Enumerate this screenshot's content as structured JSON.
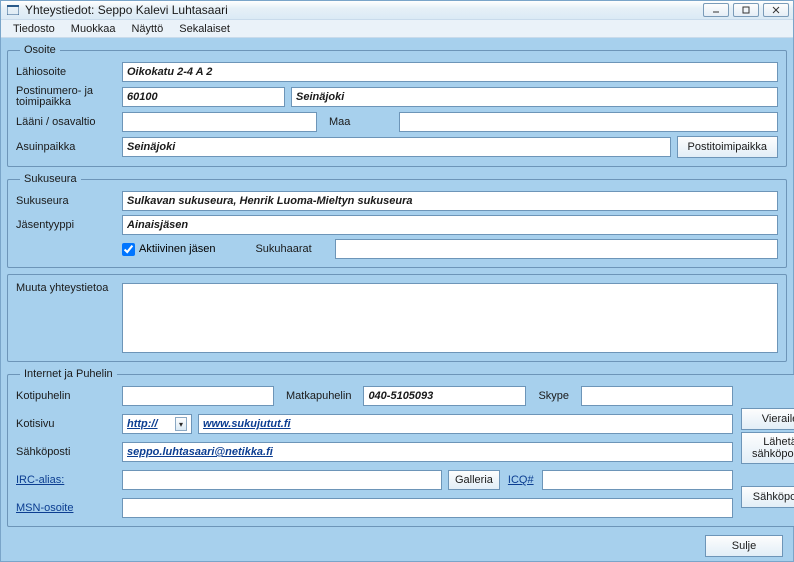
{
  "window": {
    "title": "Yhteystiedot: Seppo Kalevi Luhtasaari"
  },
  "menu": {
    "file": "Tiedosto",
    "edit": "Muokkaa",
    "view": "Näyttö",
    "misc": "Sekalaiset"
  },
  "address": {
    "legend": "Osoite",
    "street_label": "Lähiosoite",
    "street_value": "Oikokatu 2-4 A 2",
    "postal_label": "Postinumero- ja toimipaikka",
    "postal_code": "60100",
    "postal_city": "Seinäjoki",
    "state_label": "Lääni / osavaltio",
    "state_value": "",
    "country_label": "Maa",
    "country_value": "",
    "residence_label": "Asuinpaikka",
    "residence_value": "Seinäjoki",
    "postoffice_btn": "Postitoimipaikka"
  },
  "society": {
    "legend": "Sukuseura",
    "society_label": "Sukuseura",
    "society_value": "Sulkavan sukuseura, Henrik Luoma-Mieltyn sukuseura",
    "membertype_label": "Jäsentyyppi",
    "membertype_value": "Ainaisjäsen",
    "active_label": "Aktiivinen jäsen",
    "branches_label": "Sukuhaarat",
    "branches_value": ""
  },
  "other": {
    "label": "Muuta yhteystietoa",
    "value": ""
  },
  "internet": {
    "legend": "Internet ja Puhelin",
    "homephone_label": "Kotipuhelin",
    "homephone_value": "",
    "mobile_label": "Matkapuhelin",
    "mobile_value": "040-5105093",
    "skype_label": "Skype",
    "skype_value": "",
    "homepage_label": "Kotisivu",
    "protocol": "http://",
    "homepage_value": "www.sukujutut.fi",
    "email_label": "Sähköposti",
    "email_value": "seppo.luhtasaari@netikka.fi",
    "irc_label": "IRC-alias:",
    "irc_value": "",
    "gallery_btn": "Galleria",
    "icq_label": "ICQ#",
    "icq_value": "",
    "msn_label": "MSN-osoite",
    "msn_value": "",
    "visit_btn": "Vieraile",
    "sendmail_btn": "Lähetä sähköpostia",
    "email_btn": "Sähköposti"
  },
  "footer": {
    "close_btn": "Sulje"
  }
}
